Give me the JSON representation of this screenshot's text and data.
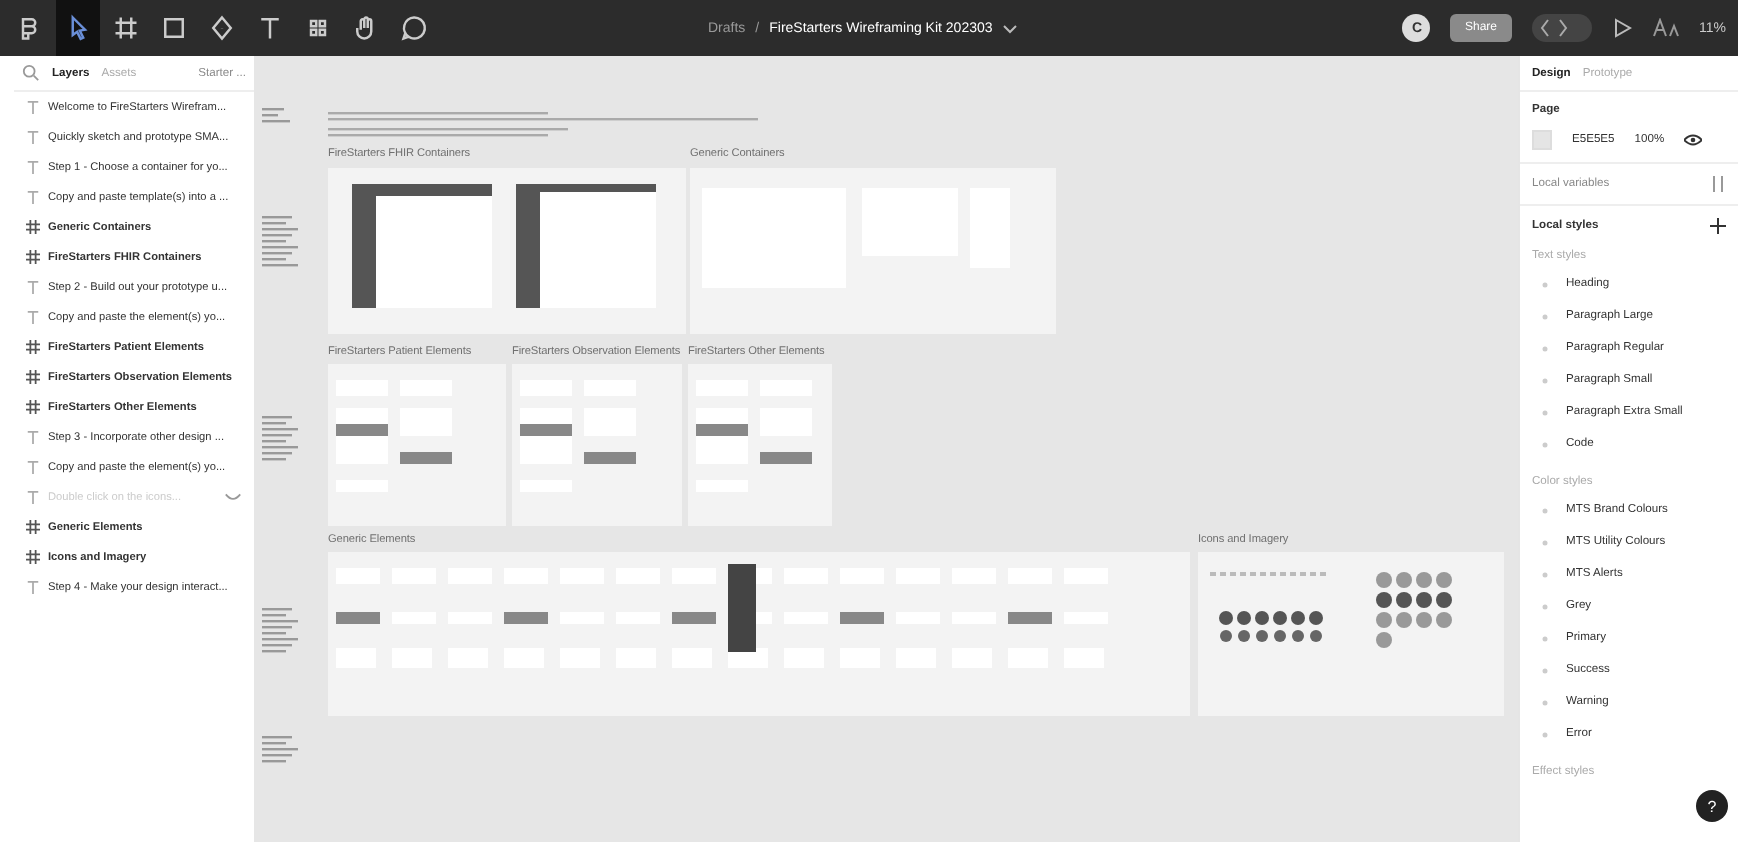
{
  "toolbar": {
    "tools": [
      {
        "kind": "menu",
        "selected": false
      },
      {
        "kind": "move",
        "selected": true
      },
      {
        "kind": "frame",
        "selected": false
      },
      {
        "kind": "shape",
        "selected": false
      },
      {
        "kind": "pen",
        "selected": false
      },
      {
        "kind": "text",
        "selected": false
      },
      {
        "kind": "resources",
        "selected": false
      },
      {
        "kind": "hand",
        "selected": false
      },
      {
        "kind": "comment",
        "selected": false
      }
    ],
    "breadcrumb": {
      "folder": "Drafts",
      "separator": "/",
      "file": "FireStarters Wireframing Kit 202303"
    },
    "avatar": "C",
    "share": "Share",
    "dev_mode": false,
    "zoom_level": "11%"
  },
  "layers_panel": {
    "tabs": [
      {
        "label": "Layers",
        "selected": true
      },
      {
        "label": "Assets",
        "selected": false
      }
    ],
    "page_select": "Starter ...",
    "items": [
      {
        "kind": "text",
        "label": "Welcome to FireStarters Wirefram...",
        "hidden": false
      },
      {
        "kind": "text",
        "label": "Quickly sketch and prototype SMA...",
        "hidden": false
      },
      {
        "kind": "text",
        "label": "Step 1 - Choose a container for yo...",
        "hidden": false
      },
      {
        "kind": "text",
        "label": "Copy and paste template(s) into a ...",
        "hidden": false
      },
      {
        "kind": "frame",
        "label": "Generic Containers",
        "hidden": false
      },
      {
        "kind": "frame",
        "label": "FireStarters FHIR Containers",
        "hidden": false
      },
      {
        "kind": "text",
        "label": "Step 2 - Build out your prototype u...",
        "hidden": false
      },
      {
        "kind": "text",
        "label": "Copy and paste the element(s) yo...",
        "hidden": false
      },
      {
        "kind": "frame",
        "label": "FireStarters Patient Elements",
        "hidden": false
      },
      {
        "kind": "frame",
        "label": "FireStarters Observation Elements",
        "hidden": false
      },
      {
        "kind": "frame",
        "label": "FireStarters Other Elements",
        "hidden": false
      },
      {
        "kind": "text",
        "label": "Step 3 - Incorporate other design ...",
        "hidden": false
      },
      {
        "kind": "text",
        "label": "Copy and paste the element(s) yo...",
        "hidden": false
      },
      {
        "kind": "text",
        "label": "Double click on the icons...",
        "hidden": true
      },
      {
        "kind": "frame",
        "label": "Generic Elements",
        "hidden": false
      },
      {
        "kind": "frame",
        "label": "Icons and Imagery",
        "hidden": false
      },
      {
        "kind": "text",
        "label": "Step 4 - Make your design interact...",
        "hidden": false
      }
    ]
  },
  "canvas": {
    "frames": [
      {
        "kind": "fhir",
        "title": "FireStarters FHIR Containers"
      },
      {
        "kind": "containers",
        "title": "Generic Containers"
      },
      {
        "kind": "patient",
        "title": "FireStarters Patient Elements"
      },
      {
        "kind": "observation",
        "title": "FireStarters Observation Elements"
      },
      {
        "kind": "other",
        "title": "FireStarters Other Elements"
      },
      {
        "kind": "elements",
        "title": "Generic Elements"
      },
      {
        "kind": "icons",
        "title": "Icons and Imagery"
      }
    ]
  },
  "design_panel": {
    "tabs": [
      {
        "label": "Design",
        "selected": true
      },
      {
        "label": "Prototype",
        "selected": false
      }
    ],
    "page": {
      "heading": "Page",
      "color": "E5E5E5",
      "opacity": "100%"
    },
    "local_variables": "Local variables",
    "local_styles": "Local styles",
    "sections": [
      {
        "heading": "Text styles",
        "items": [
          "Heading",
          "Paragraph Large",
          "Paragraph Regular",
          "Paragraph Small",
          "Paragraph Extra Small",
          "Code"
        ]
      },
      {
        "heading": "Color styles",
        "items": [
          "MTS Brand Colours",
          "MTS Utility Colours",
          "MTS Alerts",
          "Grey",
          "Primary",
          "Success",
          "Warning",
          "Error"
        ]
      },
      {
        "heading": "Effect styles"
      }
    ],
    "help": "?"
  }
}
